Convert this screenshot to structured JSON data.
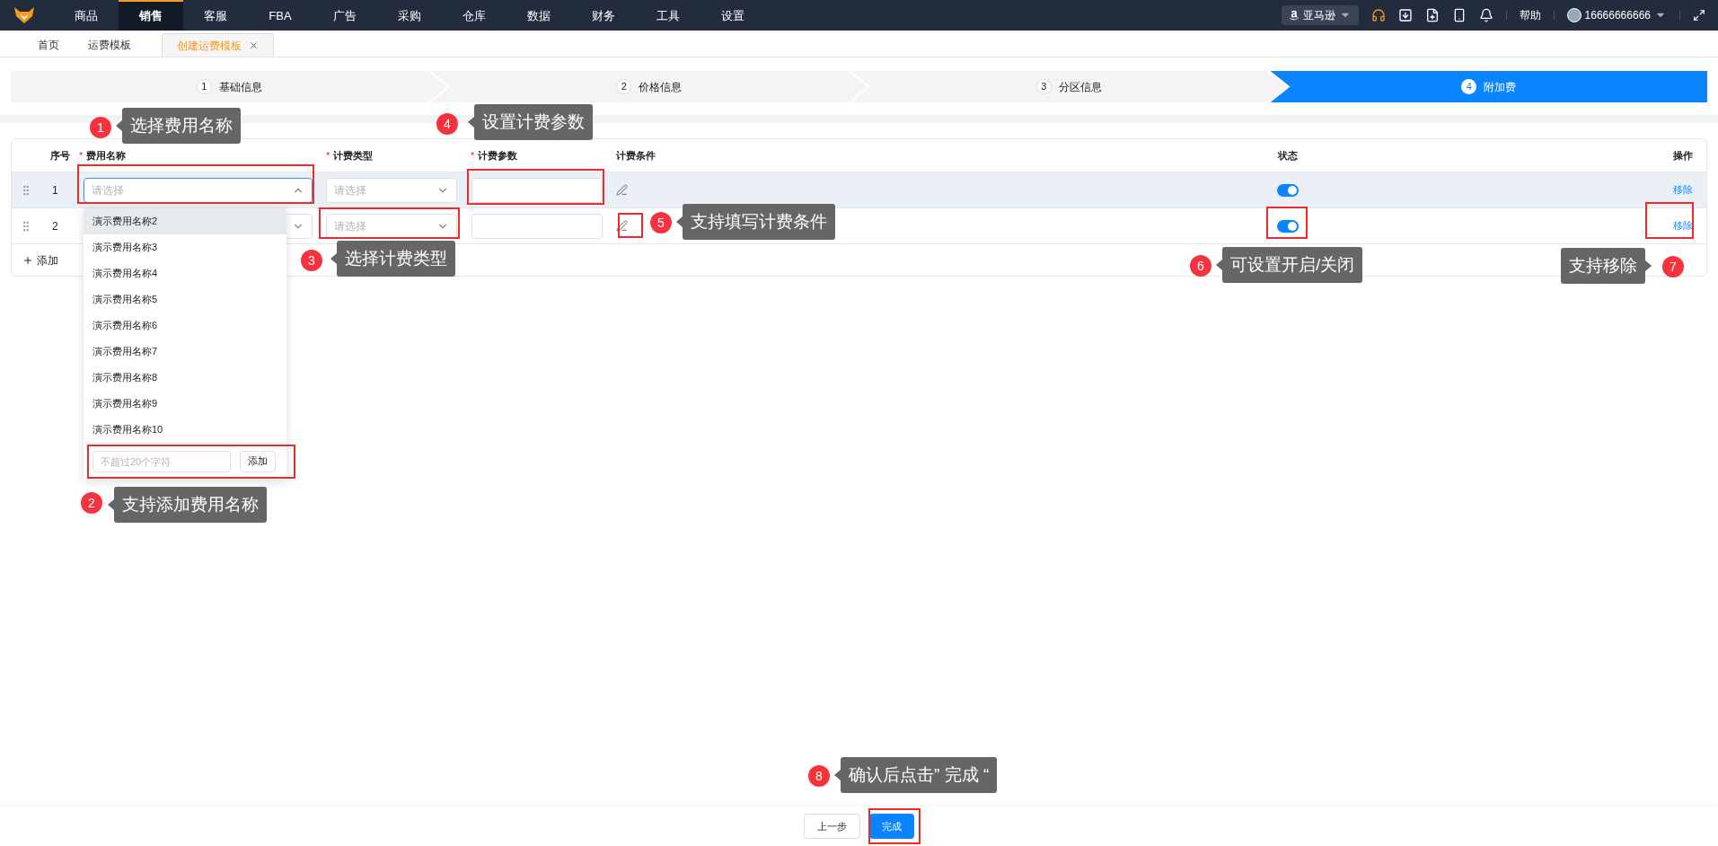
{
  "top_nav": {
    "items": [
      {
        "label": "商品",
        "selected": false
      },
      {
        "label": "销售",
        "selected": true
      },
      {
        "label": "客服",
        "selected": false
      },
      {
        "label": "FBA",
        "selected": false
      },
      {
        "label": "广告",
        "selected": false
      },
      {
        "label": "采购",
        "selected": false
      },
      {
        "label": "仓库",
        "selected": false
      },
      {
        "label": "数据",
        "selected": false
      },
      {
        "label": "财务",
        "selected": false
      },
      {
        "label": "工具",
        "selected": false
      },
      {
        "label": "设置",
        "selected": false
      }
    ],
    "marketplace": "亚马逊",
    "help": "帮助",
    "account": "16666666666"
  },
  "page_tabs": [
    {
      "label": "首页",
      "selected": false,
      "closable": false
    },
    {
      "label": "运费模板",
      "selected": false,
      "closable": false
    },
    {
      "label": "创建运费模板",
      "selected": true,
      "closable": true
    }
  ],
  "steps": [
    {
      "number": "1",
      "label": "基础信息",
      "selected": false
    },
    {
      "number": "2",
      "label": "价格信息",
      "selected": false
    },
    {
      "number": "3",
      "label": "分区信息",
      "selected": false
    },
    {
      "number": "4",
      "label": "附加费",
      "selected": true
    }
  ],
  "table": {
    "columns": [
      {
        "label": "序号"
      },
      {
        "label": "费用名称",
        "required_mark": "*"
      },
      {
        "label": "计费类型",
        "required_mark": "*"
      },
      {
        "label": "计费参数",
        "required_mark": "*"
      },
      {
        "label": "计费条件"
      },
      {
        "label": "状态"
      },
      {
        "label": "操作"
      }
    ],
    "rows": [
      {
        "index": "1",
        "highlighted": true,
        "name": {
          "placeholder": "请选择",
          "open": true
        },
        "type": {
          "placeholder": "请选择"
        },
        "status": {
          "on": true
        },
        "action": "移除"
      },
      {
        "index": "2",
        "highlighted": false,
        "name": {
          "open": false
        },
        "type": {
          "placeholder": "请选择"
        },
        "status": {
          "on": true
        },
        "action": "移除"
      }
    ],
    "add_label": "添加"
  },
  "dropdown": {
    "options": [
      {
        "label": "演示费用名称2",
        "selected": true
      },
      {
        "label": "演示费用名称3",
        "selected": false
      },
      {
        "label": "演示费用名称4",
        "selected": false
      },
      {
        "label": "演示费用名称5",
        "selected": false
      },
      {
        "label": "演示费用名称6",
        "selected": false
      },
      {
        "label": "演示费用名称7",
        "selected": false
      },
      {
        "label": "演示费用名称8",
        "selected": false
      },
      {
        "label": "演示费用名称9",
        "selected": false
      },
      {
        "label": "演示费用名称10",
        "selected": false
      }
    ],
    "new_name_placeholder": "不超过20个字符",
    "add_button": "添加"
  },
  "annotations": [
    {
      "number": "1",
      "text": "选择费用名称"
    },
    {
      "number": "2",
      "text": "支持添加费用名称"
    },
    {
      "number": "3",
      "text": "选择计费类型"
    },
    {
      "number": "4",
      "text": "设置计费参数"
    },
    {
      "number": "5",
      "text": "支持填写计费条件"
    },
    {
      "number": "6",
      "text": "可设置开启/关闭"
    },
    {
      "number": "7",
      "text": "支持移除"
    },
    {
      "number": "8",
      "text": "确认后点击”  完成  “"
    }
  ],
  "footer": {
    "buttons": [
      {
        "label": "上一步",
        "kind": "secondary"
      },
      {
        "label": "完成",
        "kind": "primary"
      }
    ]
  }
}
